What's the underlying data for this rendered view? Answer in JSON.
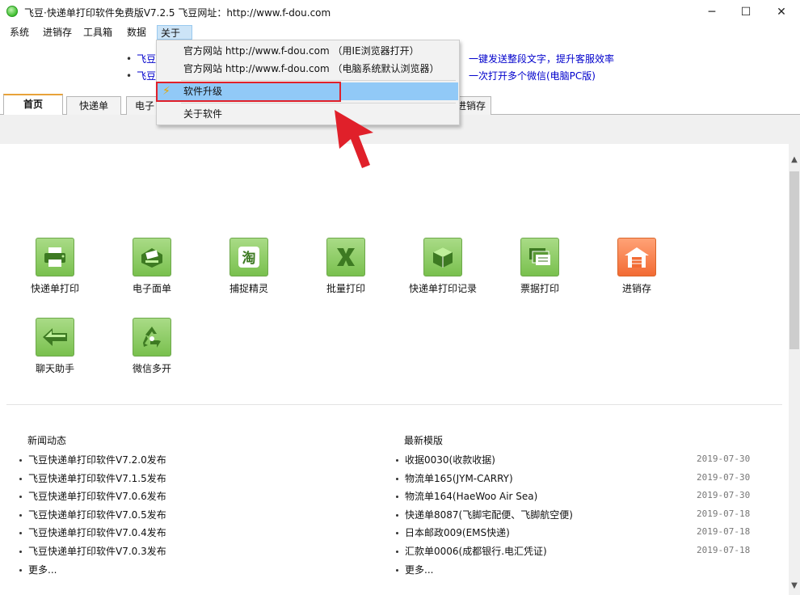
{
  "window": {
    "title": "飞豆·快递单打印软件免费版V7.2.5   飞豆网址：http://www.f-dou.com",
    "minimize": "─",
    "maximize": "☐",
    "close": "✕"
  },
  "menubar": [
    "系统",
    "进销存",
    "工具箱",
    "数据",
    "关于"
  ],
  "header": {
    "line1_left": "飞豆",
    "line1_right": "一键发送整段文字，提升客服效率",
    "line2_left": "飞豆",
    "line2_right": "一次打开多个微信(电脑PC版)"
  },
  "tabs": [
    "首页",
    "快递单",
    "电子",
    "进销存"
  ],
  "tiles": [
    {
      "label": "快递单打印",
      "icon": "printer-icon"
    },
    {
      "label": "电子面单",
      "icon": "label-printer-icon"
    },
    {
      "label": "捕捉精灵",
      "icon": "taobao-icon"
    },
    {
      "label": "批量打印",
      "icon": "excel-icon"
    },
    {
      "label": "快递单打印记录",
      "icon": "package-box-icon"
    },
    {
      "label": "票据打印",
      "icon": "bills-icon"
    },
    {
      "label": "进销存",
      "icon": "warehouse-icon"
    },
    {
      "label": "聊天助手",
      "icon": "arrow-left-icon"
    },
    {
      "label": "微信多开",
      "icon": "recycle-icon"
    }
  ],
  "news": {
    "title": "新闻动态",
    "items": [
      "飞豆快递单打印软件V7.2.0发布",
      "飞豆快递单打印软件V7.1.5发布",
      "飞豆快递单打印软件V7.0.6发布",
      "飞豆快递单打印软件V7.0.5发布",
      "飞豆快递单打印软件V7.0.4发布",
      "飞豆快递单打印软件V7.0.3发布",
      "更多..."
    ]
  },
  "templates": {
    "title": "最新模版",
    "items": [
      {
        "name": "收据0030(收款收据)",
        "date": "2019-07-30"
      },
      {
        "name": "物流单165(JYM-CARRY)",
        "date": "2019-07-30"
      },
      {
        "name": "物流单164(HaeWoo Air Sea)",
        "date": "2019-07-30"
      },
      {
        "name": "快递单8087(飞脚宅配便、飞脚航空便)",
        "date": "2019-07-18"
      },
      {
        "name": "日本邮政009(EMS快递)",
        "date": "2019-07-18"
      },
      {
        "name": "汇款单0006(成都银行.电汇凭证)",
        "date": "2019-07-18"
      },
      {
        "name": "更多...",
        "date": ""
      }
    ]
  },
  "dropdown": {
    "item1": "官方网站 http://www.f-dou.com  （用IE浏览器打开）",
    "item2": "官方网站 http://www.f-dou.com  （电脑系统默认浏览器）",
    "item3": "软件升级",
    "item4": "关于软件"
  },
  "colors": {
    "highlight": "#91c9f7",
    "annotation_red": "#e0202a",
    "tile_green": "#79c04e",
    "tile_orange": "#f26b34"
  }
}
